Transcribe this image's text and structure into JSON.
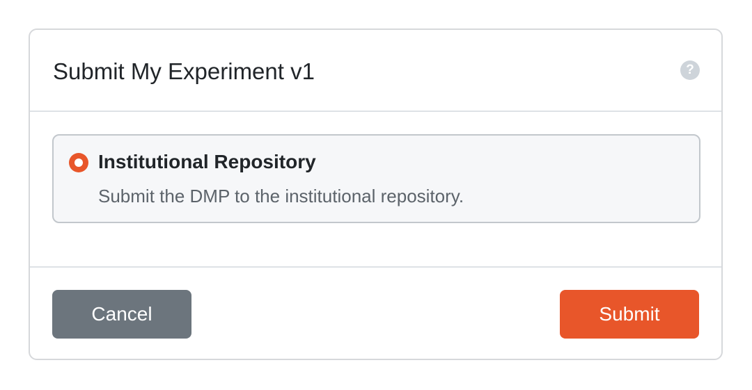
{
  "modal": {
    "title": "Submit My Experiment v1",
    "help_icon": "?"
  },
  "option": {
    "title": "Institutional Repository",
    "description": "Submit the DMP to the institutional repository.",
    "selected": true
  },
  "footer": {
    "cancel_label": "Cancel",
    "submit_label": "Submit"
  },
  "colors": {
    "accent": "#e8562a",
    "secondary": "#6c757d",
    "card_bg": "#f6f7f9"
  }
}
